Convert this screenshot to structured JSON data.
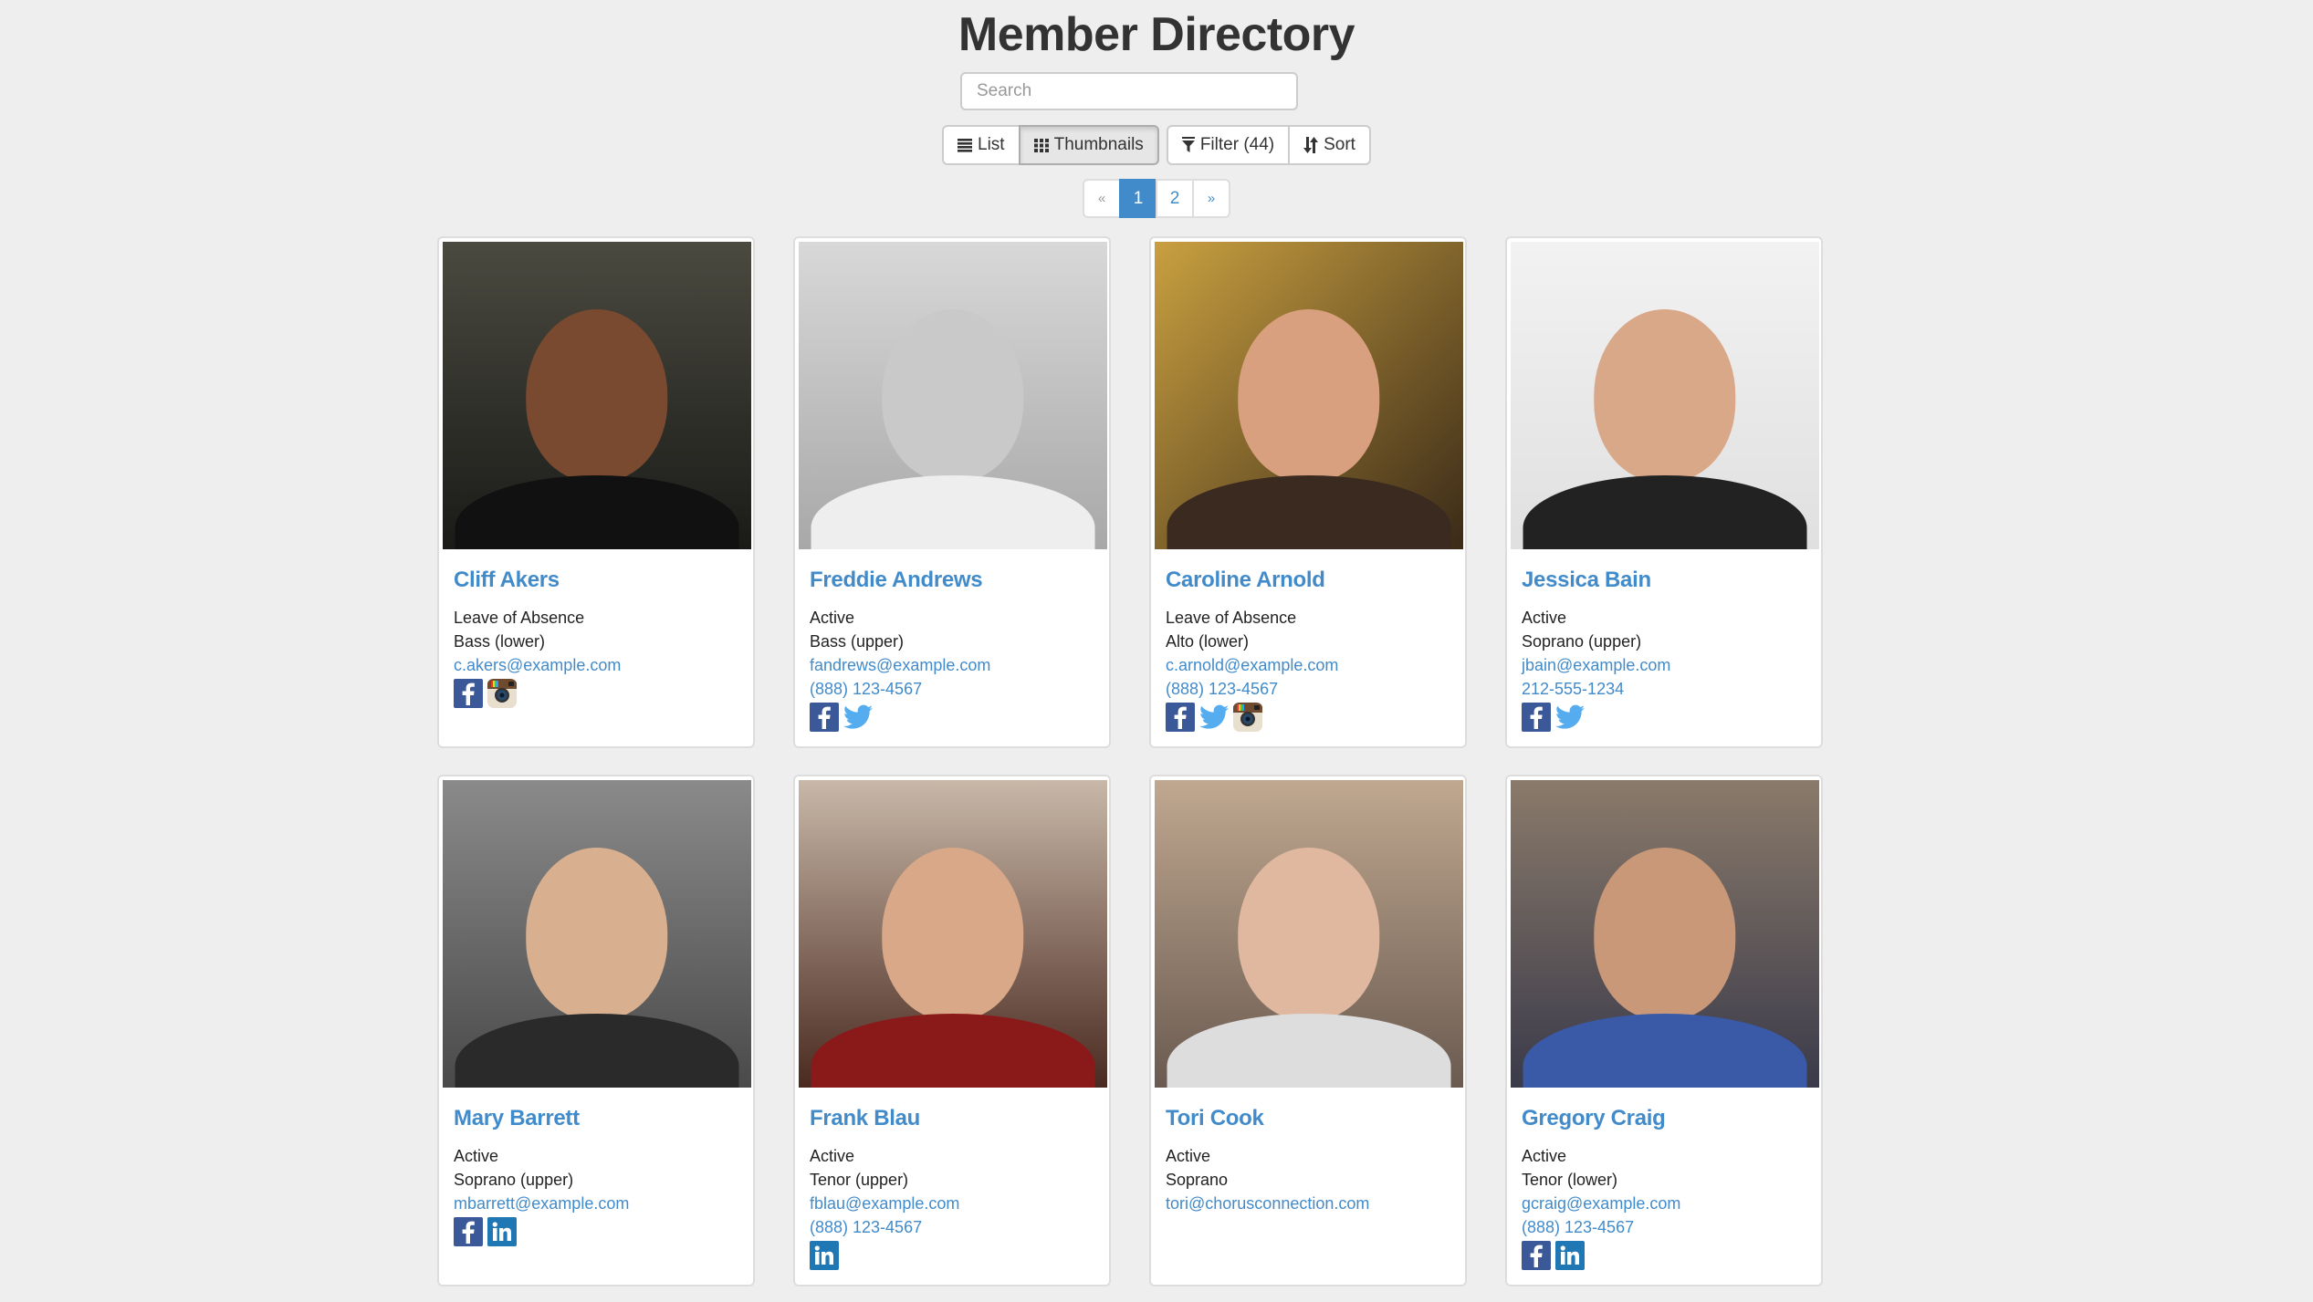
{
  "header": {
    "title": "Member Directory",
    "search_placeholder": "Search",
    "search_value": ""
  },
  "toolbar": {
    "view_buttons": [
      {
        "label": "List",
        "icon": "list-icon",
        "active": false
      },
      {
        "label": "Thumbnails",
        "icon": "grid-icon",
        "active": true
      }
    ],
    "action_buttons": [
      {
        "label": "Filter (44)",
        "icon": "filter-icon"
      },
      {
        "label": "Sort",
        "icon": "sort-icon"
      }
    ]
  },
  "pagination": {
    "prev": "«",
    "pages": [
      "1",
      "2"
    ],
    "current": "1",
    "next": "»"
  },
  "colors": {
    "accent": "#428bca",
    "background": "#eeeeee",
    "facebook": "#3b5998",
    "twitter": "#55acee",
    "linkedin": "#1f78b4"
  },
  "members": [
    {
      "name": "Cliff Akers",
      "status": "Leave of Absence",
      "voice": "Bass (lower)",
      "email": "c.akers@example.com",
      "phone": "",
      "socials": [
        "facebook",
        "instagram"
      ]
    },
    {
      "name": "Freddie Andrews",
      "status": "Active",
      "voice": "Bass (upper)",
      "email": "fandrews@example.com",
      "phone": "(888) 123-4567",
      "socials": [
        "facebook",
        "twitter"
      ]
    },
    {
      "name": "Caroline Arnold",
      "status": "Leave of Absence",
      "voice": "Alto (lower)",
      "email": "c.arnold@example.com",
      "phone": "(888) 123-4567",
      "socials": [
        "facebook",
        "twitter",
        "instagram"
      ]
    },
    {
      "name": "Jessica Bain",
      "status": "Active",
      "voice": "Soprano (upper)",
      "email": "jbain@example.com",
      "phone": "212-555-1234",
      "socials": [
        "facebook",
        "twitter"
      ]
    },
    {
      "name": "Mary Barrett",
      "status": "Active",
      "voice": "Soprano (upper)",
      "email": "mbarrett@example.com",
      "phone": "",
      "socials": [
        "facebook",
        "linkedin"
      ]
    },
    {
      "name": "Frank Blau",
      "status": "Active",
      "voice": "Tenor (upper)",
      "email": "fblau@example.com",
      "phone": "(888) 123-4567",
      "socials": [
        "linkedin"
      ]
    },
    {
      "name": "Tori Cook",
      "status": "Active",
      "voice": "Soprano",
      "email": "tori@chorusconnection.com",
      "phone": "",
      "socials": []
    },
    {
      "name": "Gregory Craig",
      "status": "Active",
      "voice": "Tenor (lower)",
      "email": "gcraig@example.com",
      "phone": "(888) 123-4567",
      "socials": [
        "facebook",
        "linkedin"
      ]
    }
  ]
}
